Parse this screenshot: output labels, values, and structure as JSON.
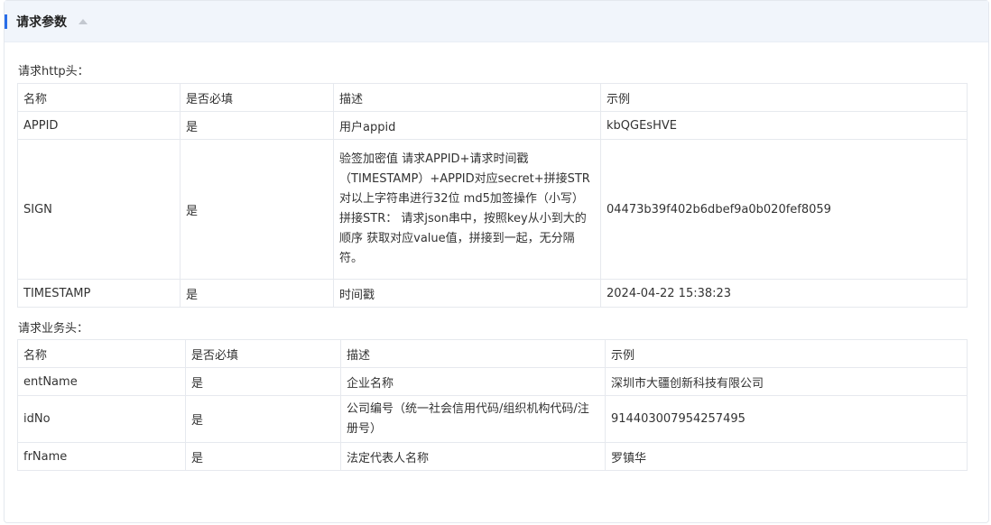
{
  "section": {
    "title": "请求参数"
  },
  "http_header": {
    "label": "请求http头：",
    "columns": [
      "名称",
      "是否必填",
      "描述",
      "示例"
    ],
    "rows": [
      {
        "name": "APPID",
        "required": "是",
        "desc": "用户appid",
        "example": "kbQGEsHVE"
      },
      {
        "name": "SIGN",
        "required": "是",
        "desc": "验签加密值 请求APPID+请求时间戳（TIMESTAMP）+APPID对应secret+拼接STR对以上字符串进行32位 md5加签操作（小写） 拼接STR： 请求json串中，按照key从小到大的顺序 获取对应value值，拼接到一起，无分隔符。",
        "example": "04473b39f402b6dbef9a0b020fef8059"
      },
      {
        "name": "TIMESTAMP",
        "required": "是",
        "desc": "时间戳",
        "example": "2024-04-22 15:38:23"
      }
    ]
  },
  "business_header": {
    "label": "请求业务头：",
    "columns": [
      "名称",
      "是否必填",
      "描述",
      "示例"
    ],
    "rows": [
      {
        "name": "entName",
        "required": "是",
        "desc": "企业名称",
        "example": "深圳市大疆创新科技有限公司"
      },
      {
        "name": "idNo",
        "required": "是",
        "desc": "公司编号（统一社会信用代码/组织机构代码/注册号）",
        "example": "914403007954257495"
      },
      {
        "name": "frName",
        "required": "是",
        "desc": "法定代表人名称",
        "example": "罗镇华"
      }
    ]
  },
  "colors": {
    "accent": "#2a6ee8",
    "header_bg": "#f1f5fb",
    "border": "#e6e9ee"
  }
}
